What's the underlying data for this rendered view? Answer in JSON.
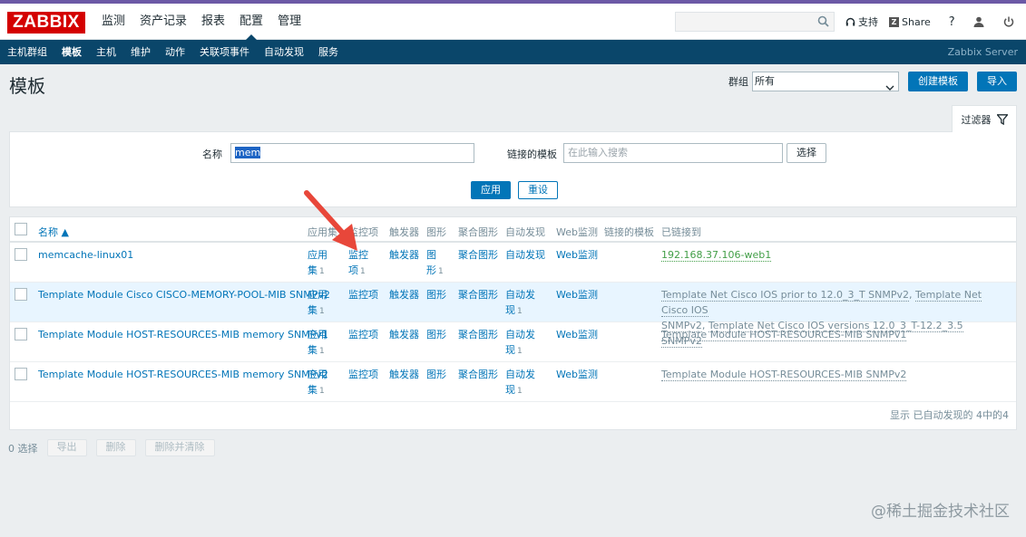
{
  "logo": "ZABBIX",
  "main_menu": [
    "监测",
    "资产记录",
    "报表",
    "配置",
    "管理"
  ],
  "main_menu_active": 3,
  "top_tools": {
    "support": "支持",
    "share": "Share",
    "help": "?"
  },
  "sub_menu": [
    "主机群组",
    "模板",
    "主机",
    "维护",
    "动作",
    "关联项事件",
    "自动发现",
    "服务"
  ],
  "sub_menu_active": 1,
  "server_name": "Zabbix Server",
  "page_title": "模板",
  "header": {
    "group_label": "群组",
    "group_value": "所有",
    "create_button": "创建模板",
    "import_button": "导入"
  },
  "filter": {
    "tab_label": "过滤器",
    "name_label": "名称",
    "name_value": "mem",
    "linked_label": "链接的模板",
    "linked_placeholder": "在此输入搜索",
    "select_button": "选择",
    "apply_button": "应用",
    "reset_button": "重设"
  },
  "table": {
    "headers": {
      "name": "名称",
      "applications": "应用集",
      "items": "监控项",
      "triggers": "触发器",
      "graphs": "图形",
      "screens": "聚合图形",
      "discovery": "自动发现",
      "web": "Web监测",
      "linked_templates": "链接的模板",
      "linked_to": "已链接到"
    },
    "rows": [
      {
        "name": "memcache-linux01",
        "app_a": "应用",
        "app_b": "集",
        "app_count": "1",
        "item_a": "监控",
        "item_b": "项",
        "item_count": "1",
        "triggers": "触发器",
        "graph_a": "图",
        "graph_b": "形",
        "graph_count": "1",
        "screens": "聚合图形",
        "disc_a": "自动发现",
        "web": "Web监测",
        "linked_to_1": "192.168.37.106-web1"
      },
      {
        "name": "Template Module Cisco CISCO-MEMORY-POOL-MIB SNMPv2",
        "app_a": "应用",
        "app_b": "集",
        "app_count": "1",
        "items": "监控项",
        "triggers": "触发器",
        "graphs": "图形",
        "screens": "聚合图形",
        "disc_a": "自动发",
        "disc_b": "现",
        "disc_count": "1",
        "web": "Web监测",
        "linked_to_1": "Template Net Cisco IOS prior to 12.0_3_T SNMPv2",
        "linked_to_sep": ", ",
        "linked_to_2a": "Template Net Cisco IOS",
        "linked_to_2b": "SNMPv2",
        "linked_to_3": "Template Net Cisco IOS versions 12.0_3_T-12.2_3.5 SNMPv2"
      },
      {
        "name": "Template Module HOST-RESOURCES-MIB memory SNMPv1",
        "app_a": "应用",
        "app_b": "集",
        "app_count": "1",
        "items": "监控项",
        "triggers": "触发器",
        "graphs": "图形",
        "screens": "聚合图形",
        "disc_a": "自动发",
        "disc_b": "现",
        "disc_count": "1",
        "web": "Web监测",
        "linked_to_1": "Template Module HOST-RESOURCES-MIB SNMPv1"
      },
      {
        "name": "Template Module HOST-RESOURCES-MIB memory SNMPv2",
        "app_a": "应用",
        "app_b": "集",
        "app_count": "1",
        "items": "监控项",
        "triggers": "触发器",
        "graphs": "图形",
        "screens": "聚合图形",
        "disc_a": "自动发",
        "disc_b": "现",
        "disc_count": "1",
        "web": "Web监测",
        "linked_to_1": "Template Module HOST-RESOURCES-MIB SNMPv2"
      }
    ],
    "footer": "显示 已自动发现的 4中的4"
  },
  "actions": {
    "selected": "0 选择",
    "export": "导出",
    "delete": "删除",
    "delete_clear": "删除并清除"
  },
  "watermark": "@稀土掘金技术社区",
  "colors": {
    "accent": "#0275b8",
    "nav_dark": "#0a466a",
    "brand_red": "#d40000",
    "linked_green": "#429e47",
    "annotation_arrow": "#e8473a"
  }
}
